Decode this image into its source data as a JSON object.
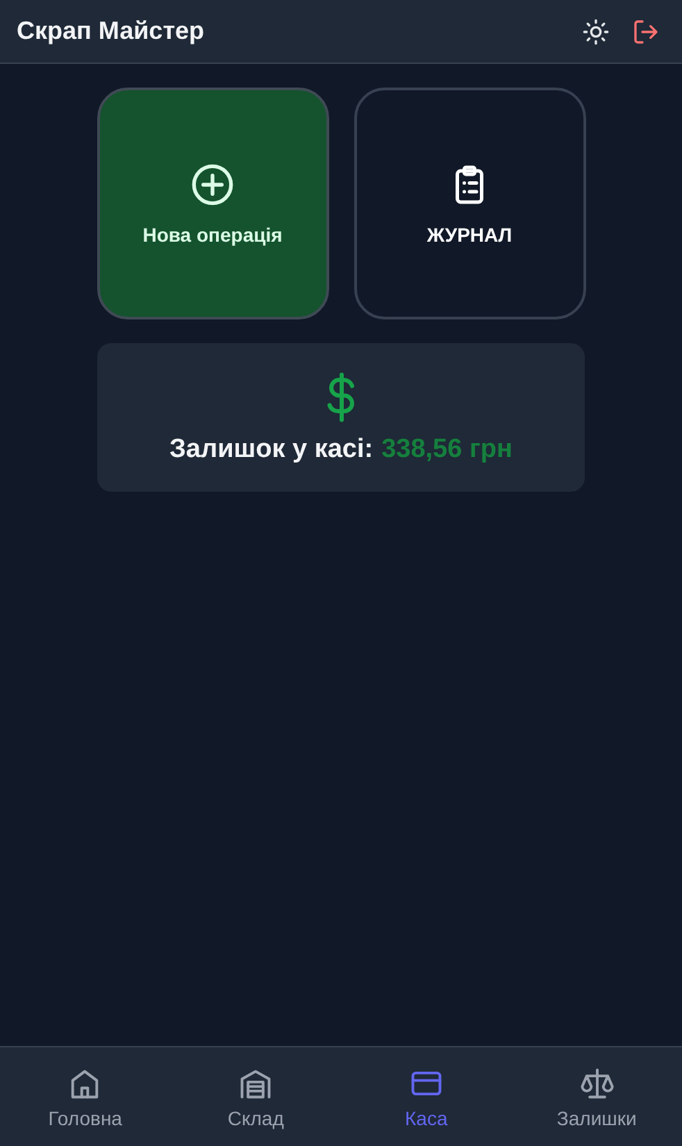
{
  "header": {
    "title": "Скрап Майстер"
  },
  "tiles": [
    {
      "kind": "new",
      "label": "Нова операція"
    },
    {
      "kind": "journal",
      "label": "ЖУРНАЛ"
    }
  ],
  "balance": {
    "label": "Залишок у касі:",
    "amount": "338,56 грн"
  },
  "nav": [
    {
      "kind": "home",
      "label": "Головна",
      "selected": false
    },
    {
      "kind": "warehouse",
      "label": "Склад",
      "selected": false
    },
    {
      "kind": "card",
      "label": "Каса",
      "selected": true
    },
    {
      "kind": "scales",
      "label": "Залишки",
      "selected": false
    }
  ]
}
